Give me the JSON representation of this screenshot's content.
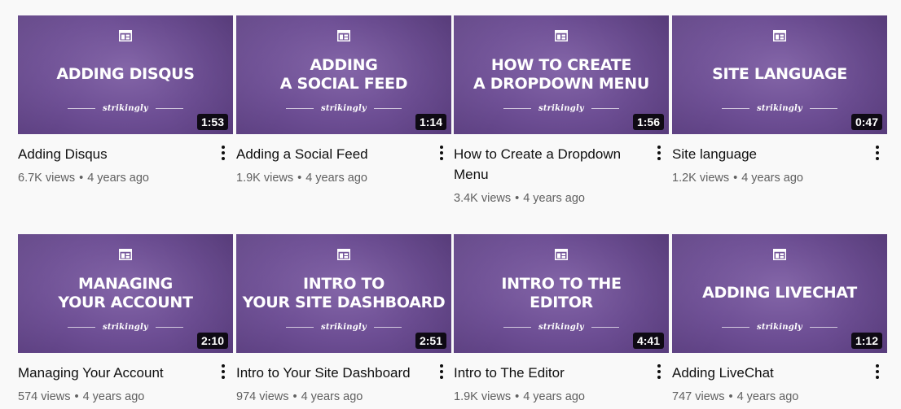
{
  "videos": [
    {
      "thumb_text": "Adding Disqus",
      "brand": "strikingly",
      "duration": "1:53",
      "title": "Adding Disqus",
      "views": "6.7K views",
      "age": "4 years ago"
    },
    {
      "thumb_text": "Adding\nA Social Feed",
      "brand": "strikingly",
      "duration": "1:14",
      "title": "Adding a Social Feed",
      "views": "1.9K views",
      "age": "4 years ago"
    },
    {
      "thumb_text": "How to Create\nA Dropdown Menu",
      "brand": "strikingly",
      "duration": "1:56",
      "title": "How to Create a Dropdown Menu",
      "views": "3.4K views",
      "age": "4 years ago"
    },
    {
      "thumb_text": "Site Language",
      "brand": "strikingly",
      "duration": "0:47",
      "title": "Site language",
      "views": "1.2K views",
      "age": "4 years ago"
    },
    {
      "thumb_text": "Managing\nYour Account",
      "brand": "strikingly",
      "duration": "2:10",
      "title": "Managing Your Account",
      "views": "574 views",
      "age": "4 years ago"
    },
    {
      "thumb_text": "Intro to\nYour Site Dashboard",
      "brand": "strikingly",
      "duration": "2:51",
      "title": "Intro to Your Site Dashboard",
      "views": "974 views",
      "age": "4 years ago"
    },
    {
      "thumb_text": "Intro to the\nEditor",
      "brand": "strikingly",
      "duration": "4:41",
      "title": "Intro to The Editor",
      "views": "1.9K views",
      "age": "4 years ago"
    },
    {
      "thumb_text": "Adding LiveChat",
      "brand": "strikingly",
      "duration": "1:12",
      "title": "Adding LiveChat",
      "views": "747 views",
      "age": "4 years ago"
    }
  ],
  "separator": "•",
  "icons": {
    "thumbnail_icon": "layout-grid-icon",
    "menu_icon": "more-vert-icon"
  },
  "colors": {
    "thumbnail_purple": "#6d4e94",
    "duration_badge": "#000000",
    "title_text": "#0f0f0f",
    "meta_text": "#606060"
  }
}
